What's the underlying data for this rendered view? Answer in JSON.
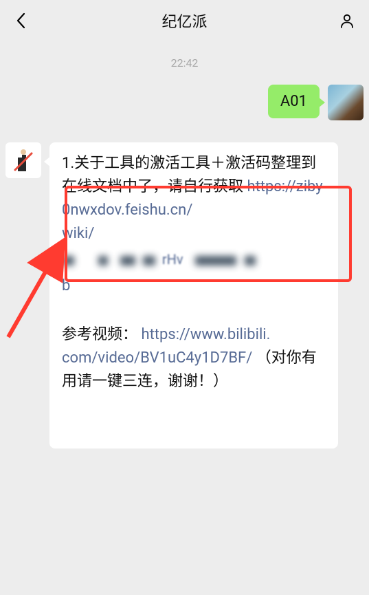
{
  "header": {
    "title": "纪亿派"
  },
  "conversation": {
    "timestamp": "22:42",
    "outgoing": {
      "text": "A01"
    },
    "incoming": {
      "line1": "1.关于工具的激活工具＋激活码整理到在线文档中了，请自行获取",
      "link1_a": "https://ziby0nwxdov.feishu.cn/",
      "link1_b": "wiki/",
      "obscured_frag_left": "",
      "obscured_frag_mid": "rHv",
      "obscured_tail": "b",
      "para2_prefix": "参考视频：",
      "link2_a": "https://www.bilibili.",
      "link2_b": "com/video/BV1uC4y1D7BF/",
      "para2_suffix": "（对你有用请一键三连，谢谢！）"
    }
  }
}
